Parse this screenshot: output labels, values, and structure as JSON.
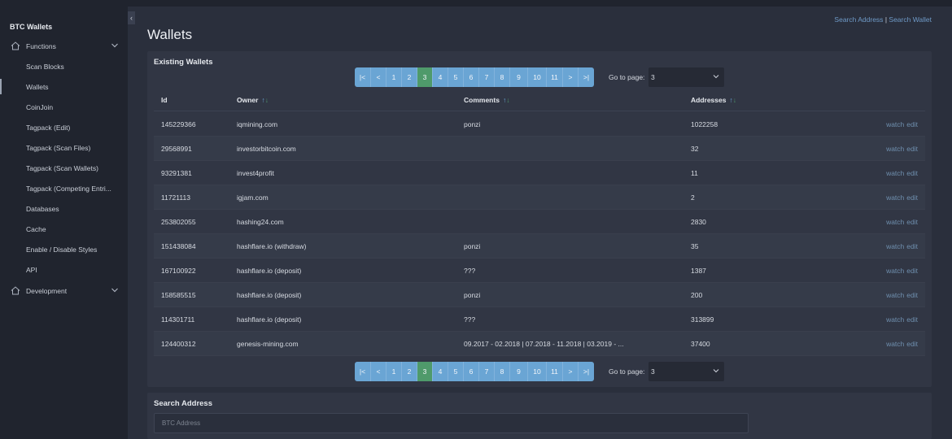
{
  "sidebar": {
    "brand": "BTC Wallets",
    "functions_label": "Functions",
    "development_label": "Development",
    "items": [
      {
        "label": "Scan Blocks"
      },
      {
        "label": "Wallets"
      },
      {
        "label": "CoinJoin"
      },
      {
        "label": "Tagpack (Edit)"
      },
      {
        "label": "Tagpack (Scan Files)"
      },
      {
        "label": "Tagpack (Scan Wallets)"
      },
      {
        "label": "Tagpack (Competing Entri..."
      },
      {
        "label": "Databases"
      },
      {
        "label": "Cache"
      },
      {
        "label": "Enable / Disable Styles"
      },
      {
        "label": "API"
      }
    ],
    "active_item": "Wallets",
    "collapse_glyph": "‹"
  },
  "header": {
    "search_address_link": "Search Address",
    "separator": "|",
    "search_wallet_link": "Search Wallet",
    "title": "Wallets"
  },
  "existing": {
    "title": "Existing Wallets",
    "pager": [
      "|<",
      "<",
      "1",
      "2",
      "3",
      "4",
      "5",
      "6",
      "7",
      "8",
      "9",
      "10",
      "11",
      ">",
      ">|"
    ],
    "active_page": "3",
    "goto_label": "Go to page:",
    "goto_value": "3",
    "columns": {
      "id": "Id",
      "owner": "Owner",
      "comments": "Comments",
      "addresses": "Addresses",
      "arrow_up": "↑",
      "arrow_down": "↓"
    },
    "rows": [
      {
        "id": "145229366",
        "owner": "iqmining.com",
        "comments": "ponzi",
        "addresses": "1022258"
      },
      {
        "id": "29568991",
        "owner": "investorbitcoin.com",
        "comments": "",
        "addresses": "32"
      },
      {
        "id": "93291381",
        "owner": "invest4profit",
        "comments": "",
        "addresses": "11"
      },
      {
        "id": "11721113",
        "owner": "igjam.com",
        "comments": "",
        "addresses": "2"
      },
      {
        "id": "253802055",
        "owner": "hashing24.com",
        "comments": "",
        "addresses": "2830"
      },
      {
        "id": "151438084",
        "owner": "hashflare.io (withdraw)",
        "comments": "ponzi",
        "addresses": "35"
      },
      {
        "id": "167100922",
        "owner": "hashflare.io (deposit)",
        "comments": "???",
        "addresses": "1387"
      },
      {
        "id": "158585515",
        "owner": "hashflare.io (deposit)",
        "comments": "ponzi",
        "addresses": "200"
      },
      {
        "id": "114301711",
        "owner": "hashflare.io (deposit)",
        "comments": "???",
        "addresses": "313899"
      },
      {
        "id": "124400312",
        "owner": "genesis-mining.com",
        "comments": "09.2017 - 02.2018 | 07.2018 - 11.2018 | 03.2019 - ...",
        "addresses": "37400"
      }
    ],
    "watch_label": "watch",
    "edit_label": "edit"
  },
  "search": {
    "title": "Search Address",
    "placeholder": "BTC Address"
  },
  "colors": {
    "accent_blue": "#6aa5d4",
    "active_green": "#4f9a6b",
    "link": "#6f9ac7"
  }
}
